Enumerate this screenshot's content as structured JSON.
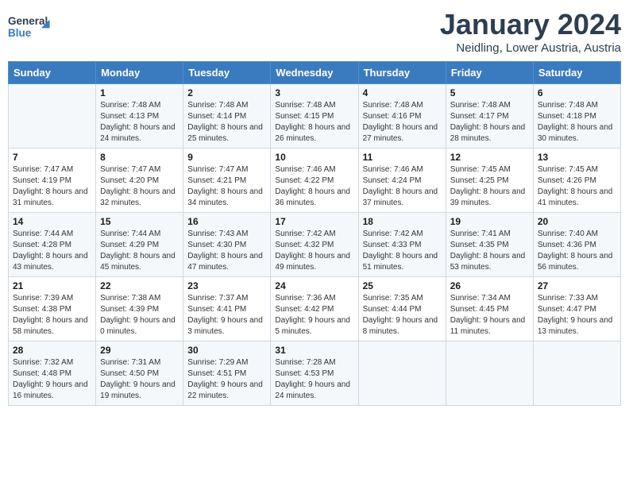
{
  "header": {
    "logo_line1": "General",
    "logo_line2": "Blue",
    "month": "January 2024",
    "location": "Neidling, Lower Austria, Austria"
  },
  "weekdays": [
    "Sunday",
    "Monday",
    "Tuesday",
    "Wednesday",
    "Thursday",
    "Friday",
    "Saturday"
  ],
  "weeks": [
    [
      {
        "day": "",
        "sunrise": "",
        "sunset": "",
        "daylight": ""
      },
      {
        "day": "1",
        "sunrise": "Sunrise: 7:48 AM",
        "sunset": "Sunset: 4:13 PM",
        "daylight": "Daylight: 8 hours and 24 minutes."
      },
      {
        "day": "2",
        "sunrise": "Sunrise: 7:48 AM",
        "sunset": "Sunset: 4:14 PM",
        "daylight": "Daylight: 8 hours and 25 minutes."
      },
      {
        "day": "3",
        "sunrise": "Sunrise: 7:48 AM",
        "sunset": "Sunset: 4:15 PM",
        "daylight": "Daylight: 8 hours and 26 minutes."
      },
      {
        "day": "4",
        "sunrise": "Sunrise: 7:48 AM",
        "sunset": "Sunset: 4:16 PM",
        "daylight": "Daylight: 8 hours and 27 minutes."
      },
      {
        "day": "5",
        "sunrise": "Sunrise: 7:48 AM",
        "sunset": "Sunset: 4:17 PM",
        "daylight": "Daylight: 8 hours and 28 minutes."
      },
      {
        "day": "6",
        "sunrise": "Sunrise: 7:48 AM",
        "sunset": "Sunset: 4:18 PM",
        "daylight": "Daylight: 8 hours and 30 minutes."
      }
    ],
    [
      {
        "day": "7",
        "sunrise": "Sunrise: 7:47 AM",
        "sunset": "Sunset: 4:19 PM",
        "daylight": "Daylight: 8 hours and 31 minutes."
      },
      {
        "day": "8",
        "sunrise": "Sunrise: 7:47 AM",
        "sunset": "Sunset: 4:20 PM",
        "daylight": "Daylight: 8 hours and 32 minutes."
      },
      {
        "day": "9",
        "sunrise": "Sunrise: 7:47 AM",
        "sunset": "Sunset: 4:21 PM",
        "daylight": "Daylight: 8 hours and 34 minutes."
      },
      {
        "day": "10",
        "sunrise": "Sunrise: 7:46 AM",
        "sunset": "Sunset: 4:22 PM",
        "daylight": "Daylight: 8 hours and 36 minutes."
      },
      {
        "day": "11",
        "sunrise": "Sunrise: 7:46 AM",
        "sunset": "Sunset: 4:24 PM",
        "daylight": "Daylight: 8 hours and 37 minutes."
      },
      {
        "day": "12",
        "sunrise": "Sunrise: 7:45 AM",
        "sunset": "Sunset: 4:25 PM",
        "daylight": "Daylight: 8 hours and 39 minutes."
      },
      {
        "day": "13",
        "sunrise": "Sunrise: 7:45 AM",
        "sunset": "Sunset: 4:26 PM",
        "daylight": "Daylight: 8 hours and 41 minutes."
      }
    ],
    [
      {
        "day": "14",
        "sunrise": "Sunrise: 7:44 AM",
        "sunset": "Sunset: 4:28 PM",
        "daylight": "Daylight: 8 hours and 43 minutes."
      },
      {
        "day": "15",
        "sunrise": "Sunrise: 7:44 AM",
        "sunset": "Sunset: 4:29 PM",
        "daylight": "Daylight: 8 hours and 45 minutes."
      },
      {
        "day": "16",
        "sunrise": "Sunrise: 7:43 AM",
        "sunset": "Sunset: 4:30 PM",
        "daylight": "Daylight: 8 hours and 47 minutes."
      },
      {
        "day": "17",
        "sunrise": "Sunrise: 7:42 AM",
        "sunset": "Sunset: 4:32 PM",
        "daylight": "Daylight: 8 hours and 49 minutes."
      },
      {
        "day": "18",
        "sunrise": "Sunrise: 7:42 AM",
        "sunset": "Sunset: 4:33 PM",
        "daylight": "Daylight: 8 hours and 51 minutes."
      },
      {
        "day": "19",
        "sunrise": "Sunrise: 7:41 AM",
        "sunset": "Sunset: 4:35 PM",
        "daylight": "Daylight: 8 hours and 53 minutes."
      },
      {
        "day": "20",
        "sunrise": "Sunrise: 7:40 AM",
        "sunset": "Sunset: 4:36 PM",
        "daylight": "Daylight: 8 hours and 56 minutes."
      }
    ],
    [
      {
        "day": "21",
        "sunrise": "Sunrise: 7:39 AM",
        "sunset": "Sunset: 4:38 PM",
        "daylight": "Daylight: 8 hours and 58 minutes."
      },
      {
        "day": "22",
        "sunrise": "Sunrise: 7:38 AM",
        "sunset": "Sunset: 4:39 PM",
        "daylight": "Daylight: 9 hours and 0 minutes."
      },
      {
        "day": "23",
        "sunrise": "Sunrise: 7:37 AM",
        "sunset": "Sunset: 4:41 PM",
        "daylight": "Daylight: 9 hours and 3 minutes."
      },
      {
        "day": "24",
        "sunrise": "Sunrise: 7:36 AM",
        "sunset": "Sunset: 4:42 PM",
        "daylight": "Daylight: 9 hours and 5 minutes."
      },
      {
        "day": "25",
        "sunrise": "Sunrise: 7:35 AM",
        "sunset": "Sunset: 4:44 PM",
        "daylight": "Daylight: 9 hours and 8 minutes."
      },
      {
        "day": "26",
        "sunrise": "Sunrise: 7:34 AM",
        "sunset": "Sunset: 4:45 PM",
        "daylight": "Daylight: 9 hours and 11 minutes."
      },
      {
        "day": "27",
        "sunrise": "Sunrise: 7:33 AM",
        "sunset": "Sunset: 4:47 PM",
        "daylight": "Daylight: 9 hours and 13 minutes."
      }
    ],
    [
      {
        "day": "28",
        "sunrise": "Sunrise: 7:32 AM",
        "sunset": "Sunset: 4:48 PM",
        "daylight": "Daylight: 9 hours and 16 minutes."
      },
      {
        "day": "29",
        "sunrise": "Sunrise: 7:31 AM",
        "sunset": "Sunset: 4:50 PM",
        "daylight": "Daylight: 9 hours and 19 minutes."
      },
      {
        "day": "30",
        "sunrise": "Sunrise: 7:29 AM",
        "sunset": "Sunset: 4:51 PM",
        "daylight": "Daylight: 9 hours and 22 minutes."
      },
      {
        "day": "31",
        "sunrise": "Sunrise: 7:28 AM",
        "sunset": "Sunset: 4:53 PM",
        "daylight": "Daylight: 9 hours and 24 minutes."
      },
      {
        "day": "",
        "sunrise": "",
        "sunset": "",
        "daylight": ""
      },
      {
        "day": "",
        "sunrise": "",
        "sunset": "",
        "daylight": ""
      },
      {
        "day": "",
        "sunrise": "",
        "sunset": "",
        "daylight": ""
      }
    ]
  ]
}
